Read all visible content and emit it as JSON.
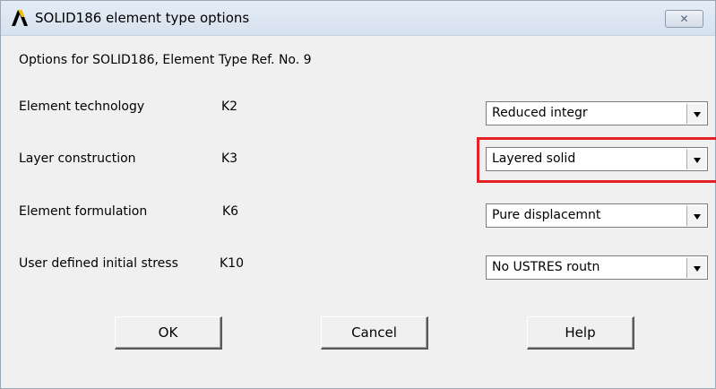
{
  "window": {
    "title": "SOLID186 element type options",
    "close_icon": "close-x-icon",
    "app_icon": "ansys-logo-icon"
  },
  "subtitle": "Options for SOLID186, Element Type Ref. No. 9",
  "options": [
    {
      "label": "Element technology",
      "key": "K2",
      "value": "Reduced integr"
    },
    {
      "label": "Layer construction",
      "key": "K3",
      "value": "Layered solid"
    },
    {
      "label": "Element formulation",
      "key": "K6",
      "value": "Pure displacemnt"
    },
    {
      "label": "User defined initial stress",
      "key": "K10",
      "value": "No USTRES routn"
    }
  ],
  "buttons": {
    "ok": "OK",
    "cancel": "Cancel",
    "help": "Help"
  },
  "colors": {
    "highlight": "#e32124",
    "titlebar": "#dde7f2",
    "background": "#f0f0f0"
  }
}
